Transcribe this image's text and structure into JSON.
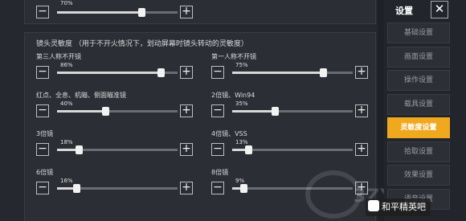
{
  "top_slider": {
    "value": "70%",
    "percent": 70
  },
  "section": {
    "title": "镜头灵敏度 （用于不开火情况下，划动屏幕时镜头转动的灵敏度）"
  },
  "sliders": [
    {
      "label": "第三人称不开镜",
      "value": "86%",
      "percent": 86
    },
    {
      "label": "第一人称不开镜",
      "value": "75%",
      "percent": 75
    },
    {
      "label": "红点、全息、机瞄、侧面瞄准镜",
      "value": "40%",
      "percent": 40
    },
    {
      "label": "2倍镜、Win94",
      "value": "35%",
      "percent": 35
    },
    {
      "label": "3倍镜",
      "value": "18%",
      "percent": 18
    },
    {
      "label": "4倍镜、VSS",
      "value": "13%",
      "percent": 13
    },
    {
      "label": "6倍镜",
      "value": "16%",
      "percent": 16
    },
    {
      "label": "8倍镜",
      "value": "9%",
      "percent": 9
    }
  ],
  "buttons": {
    "minus": "−",
    "plus": "+"
  },
  "sidebar": {
    "title": "设置",
    "close": "✕",
    "items": [
      {
        "label": "基础设置"
      },
      {
        "label": "画面设置"
      },
      {
        "label": "操作设置"
      },
      {
        "label": "载具设置"
      },
      {
        "label": "灵敏度设置",
        "active": true
      },
      {
        "label": "拾取设置"
      },
      {
        "label": "效果设置"
      },
      {
        "label": "语音设置"
      }
    ]
  },
  "watermark": {
    "text": "3ZY.net"
  },
  "credit": {
    "text": "和平精英吧"
  }
}
